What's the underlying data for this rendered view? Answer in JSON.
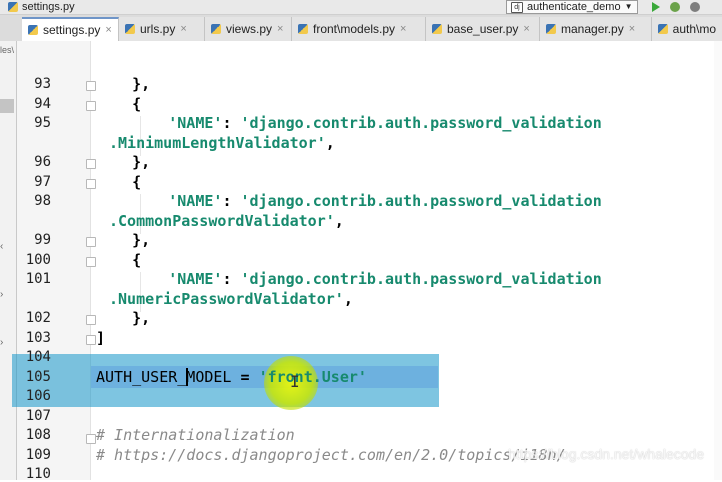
{
  "topbar": {
    "file_name": "settings.py",
    "run_config": "authenticate_demo",
    "run_config_arrow": "▼"
  },
  "tabs": [
    {
      "label": "settings.py"
    },
    {
      "label": "urls.py"
    },
    {
      "label": "views.py"
    },
    {
      "label": "front\\models.py"
    },
    {
      "label": "base_user.py"
    },
    {
      "label": "manager.py"
    },
    {
      "label": "auth\\mo"
    }
  ],
  "left_pane": {
    "crumb": "les\\"
  },
  "editor": {
    "lines": [
      {
        "no": "93",
        "code": "    },"
      },
      {
        "no": "94",
        "code": "    {"
      },
      {
        "no": "95",
        "key": "        'NAME'",
        "sep": ": ",
        "val": "'django.contrib.auth.password_validation"
      },
      {
        "no": "",
        "cont": ".MinimumLengthValidator'",
        "tail": ","
      },
      {
        "no": "96",
        "code": "    },"
      },
      {
        "no": "97",
        "code": "    {"
      },
      {
        "no": "98",
        "key": "        'NAME'",
        "sep": ": ",
        "val": "'django.contrib.auth.password_validation"
      },
      {
        "no": "",
        "cont": ".CommonPasswordValidator'",
        "tail": ","
      },
      {
        "no": "99",
        "code": "    },"
      },
      {
        "no": "100",
        "code": "    {"
      },
      {
        "no": "101",
        "key": "        'NAME'",
        "sep": ": ",
        "val": "'django.contrib.auth.password_validation"
      },
      {
        "no": "",
        "cont": ".NumericPasswordValidator'",
        "tail": ","
      },
      {
        "no": "102",
        "code": "    },"
      },
      {
        "no": "103",
        "code": "]"
      },
      {
        "no": "104",
        "code": ""
      },
      {
        "no": "105",
        "ident": "AUTH_USER_MODEL",
        "op": " = ",
        "val": "'front.User'"
      },
      {
        "no": "106",
        "code": ""
      },
      {
        "no": "107",
        "code": ""
      },
      {
        "no": "108",
        "comment": "# Internationalization"
      },
      {
        "no": "109",
        "comment": "# https://docs.djangoproject.com/en/2.0/topics/i18n/"
      },
      {
        "no": "110",
        "code": ""
      }
    ]
  },
  "watermark": "https://blog.csdn.net/whalecode",
  "icons": [
    "python-file-icon",
    "django-icon",
    "run-icon",
    "debug-icon",
    "coverage-icon",
    "close-icon",
    "fold-marker-icon",
    "text-cursor-icon"
  ]
}
